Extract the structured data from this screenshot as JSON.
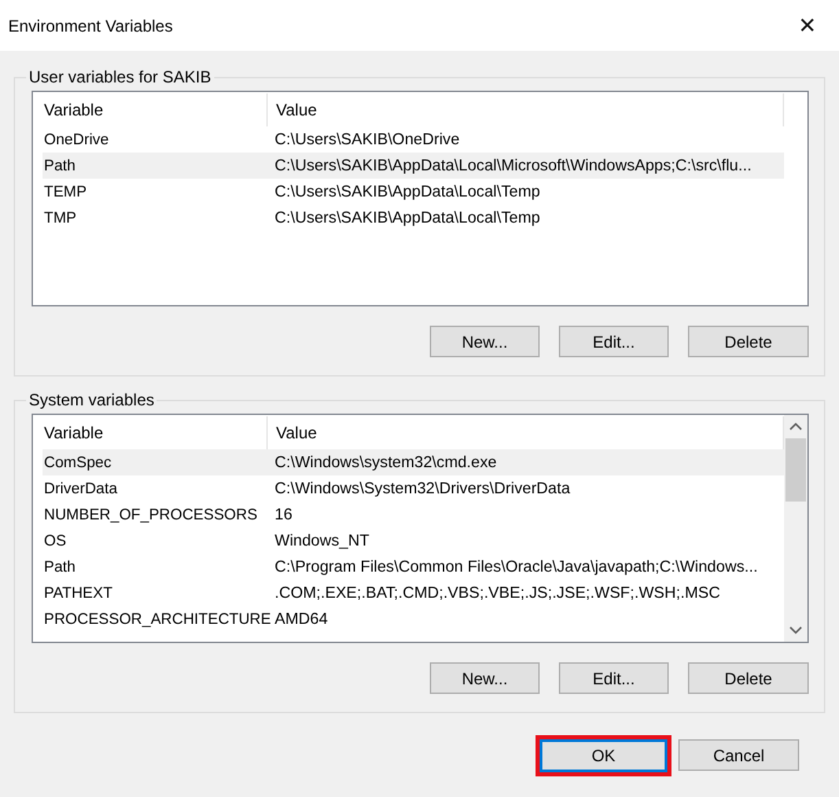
{
  "window": {
    "title": "Environment Variables",
    "close": "✕"
  },
  "groups": [
    {
      "title": "User variables for SAKIB",
      "columns": [
        "Variable",
        "Value"
      ],
      "scrollbar": false,
      "rows": [
        {
          "variable": "OneDrive",
          "value": "C:\\Users\\SAKIB\\OneDrive",
          "selected": false
        },
        {
          "variable": "Path",
          "value": "C:\\Users\\SAKIB\\AppData\\Local\\Microsoft\\WindowsApps;C:\\src\\flu...",
          "selected": true
        },
        {
          "variable": "TEMP",
          "value": "C:\\Users\\SAKIB\\AppData\\Local\\Temp",
          "selected": false
        },
        {
          "variable": "TMP",
          "value": "C:\\Users\\SAKIB\\AppData\\Local\\Temp",
          "selected": false
        }
      ],
      "buttons": [
        "New...",
        "Edit...",
        "Delete"
      ]
    },
    {
      "title": "System variables",
      "columns": [
        "Variable",
        "Value"
      ],
      "scrollbar": true,
      "rows": [
        {
          "variable": "ComSpec",
          "value": "C:\\Windows\\system32\\cmd.exe",
          "selected": true
        },
        {
          "variable": "DriverData",
          "value": "C:\\Windows\\System32\\Drivers\\DriverData",
          "selected": false
        },
        {
          "variable": "NUMBER_OF_PROCESSORS",
          "value": "16",
          "selected": false
        },
        {
          "variable": "OS",
          "value": "Windows_NT",
          "selected": false
        },
        {
          "variable": "Path",
          "value": "C:\\Program Files\\Common Files\\Oracle\\Java\\javapath;C:\\Windows...",
          "selected": false
        },
        {
          "variable": "PATHEXT",
          "value": ".COM;.EXE;.BAT;.CMD;.VBS;.VBE;.JS;.JSE;.WSF;.WSH;.MSC",
          "selected": false
        },
        {
          "variable": "PROCESSOR_ARCHITECTURE",
          "value": "AMD64",
          "selected": false
        }
      ],
      "buttons": [
        "New...",
        "Edit...",
        "Delete"
      ]
    }
  ],
  "footer_buttons": [
    {
      "label": "OK",
      "default": true,
      "highlighted": true
    },
    {
      "label": "Cancel",
      "default": false,
      "highlighted": false
    }
  ]
}
